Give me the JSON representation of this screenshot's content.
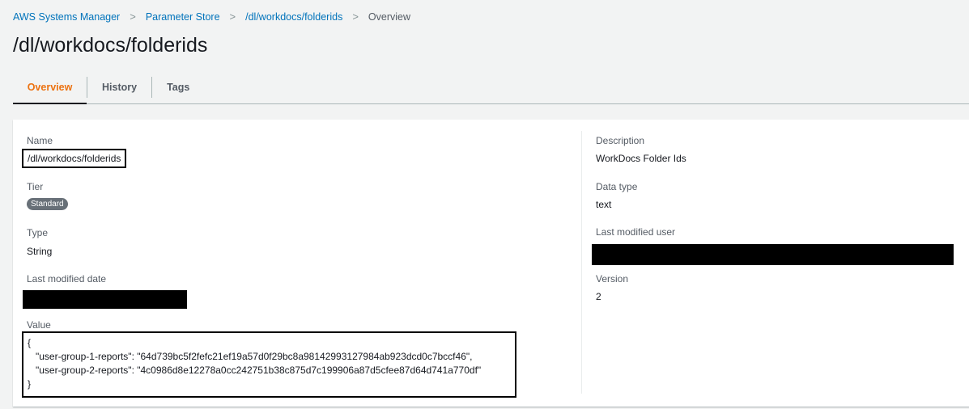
{
  "breadcrumb": [
    "AWS Systems Manager",
    "Parameter Store",
    "/dl/workdocs/folderids",
    "Overview"
  ],
  "title": "/dl/workdocs/folderids",
  "tabs": [
    "Overview",
    "History",
    "Tags"
  ],
  "left": {
    "name_label": "Name",
    "name_value": "/dl/workdocs/folderids",
    "tier_label": "Tier",
    "tier_value": "Standard",
    "type_label": "Type",
    "type_value": "String",
    "lmd_label": "Last modified date",
    "value_label": "Value",
    "value_lines": [
      "{",
      "   \"user-group-1-reports\": \"64d739bc5f2fefc21ef19a57d0f29bc8a98142993127984ab923dcd0c7bccf46\",",
      "   \"user-group-2-reports\": \"4c0986d8e12278a0cc242751b38c875d7c199906a87d5cfee87d64d741a770df\"",
      "}"
    ]
  },
  "right": {
    "desc_label": "Description",
    "desc_value": "WorkDocs Folder Ids",
    "dt_label": "Data type",
    "dt_value": "text",
    "lmu_label": "Last modified user",
    "ver_label": "Version",
    "ver_value": "2"
  }
}
